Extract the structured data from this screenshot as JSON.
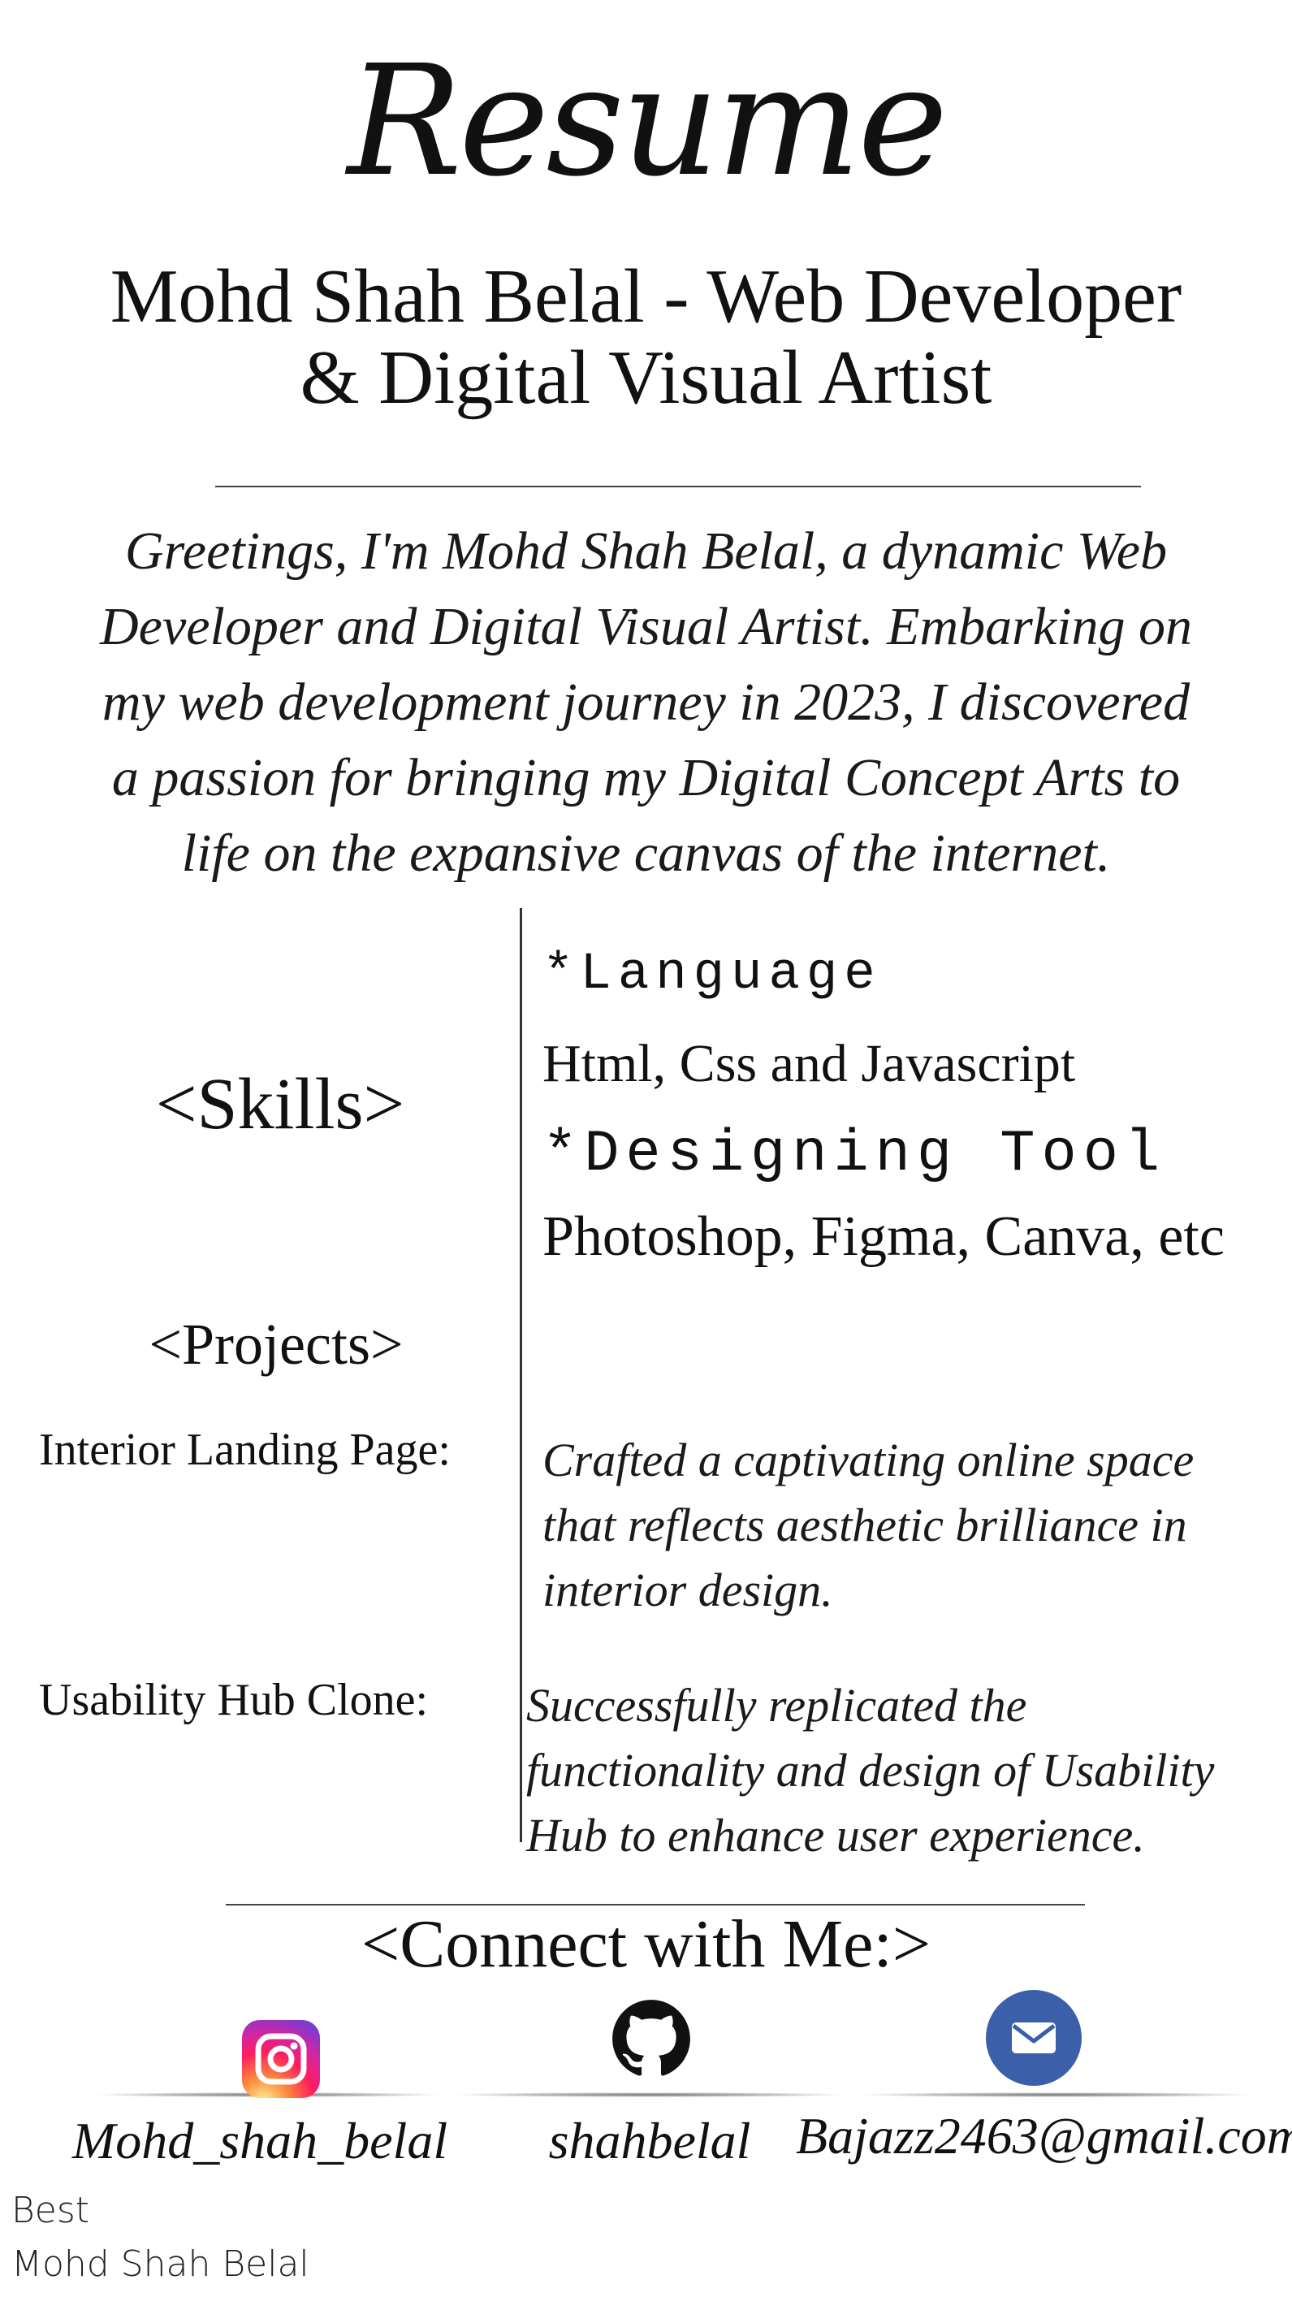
{
  "header": {
    "title": "Resume"
  },
  "profile": {
    "role_line1": "Mohd Shah Belal - Web Developer",
    "role_line2": "& Digital Visual Artist",
    "about_line1": "Greetings, I'm Mohd Shah Belal, a dynamic Web",
    "about_line2": "Developer and Digital Visual Artist. Embarking on",
    "about_line3": "my web development journey in 2023, I discovered",
    "about_line4": "a passion for bringing my Digital Concept Arts to",
    "about_line5": "life on the expansive canvas of the internet."
  },
  "skills": {
    "title": "<Skills>",
    "language_label": "*Language",
    "language_value": "Html, Css and Javascript",
    "tool_label": "*Designing Tool",
    "tool_value": "Photoshop, Figma, Canva, etc"
  },
  "projects": {
    "title": "<Projects>",
    "items": [
      {
        "name": "Interior Landing Page:",
        "desc_line1": "Crafted a captivating online space",
        "desc_line2": "that reflects aesthetic brilliance in",
        "desc_line3": "interior design."
      },
      {
        "name": "Usability Hub Clone:",
        "desc_line1": "Successfully replicated the",
        "desc_line2": "functionality and design of Usability",
        "desc_line3": "Hub to enhance user experience."
      }
    ]
  },
  "connect": {
    "title": "<Connect with Me:>",
    "links": [
      {
        "icon": "instagram-icon",
        "handle": "Mohd_shah_belal"
      },
      {
        "icon": "github-icon",
        "handle": "shahbelal"
      },
      {
        "icon": "mail-icon",
        "handle": "Bajazz2463@gmail.com"
      }
    ]
  },
  "signature": {
    "line1": "Best",
    "line2": "Mohd Shah Belal"
  },
  "colors": {
    "instagram": "#d6249f",
    "mail": "#3b5fa8",
    "text": "#111111"
  }
}
